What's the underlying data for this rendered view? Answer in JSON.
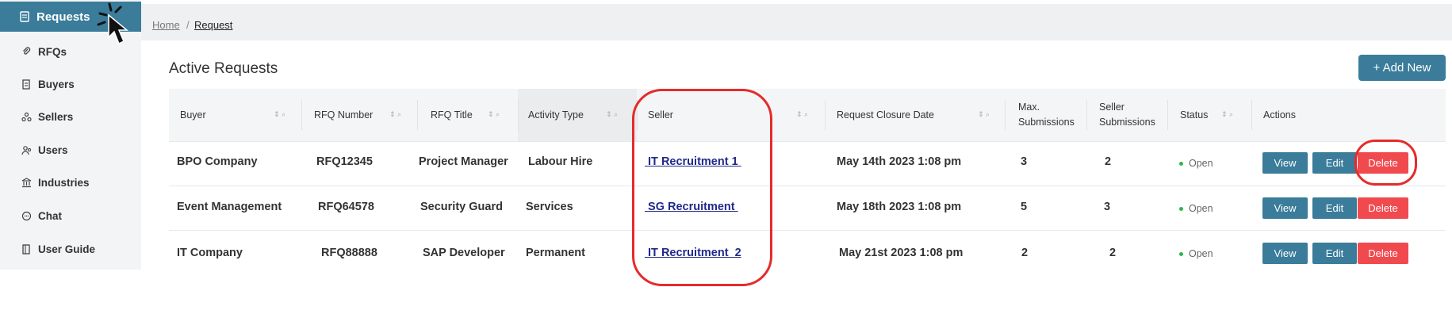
{
  "sidebar": {
    "items": [
      {
        "label": "Requests",
        "icon": "request-doc-icon",
        "active": true
      },
      {
        "label": "RFQs",
        "icon": "paperclip-icon"
      },
      {
        "label": "Buyers",
        "icon": "receipt-icon"
      },
      {
        "label": "Sellers",
        "icon": "sellers-icon"
      },
      {
        "label": "Users",
        "icon": "users-icon"
      },
      {
        "label": "Industries",
        "icon": "bank-icon"
      },
      {
        "label": "Chat",
        "icon": "chat-icon"
      },
      {
        "label": "User Guide",
        "icon": "book-icon"
      }
    ]
  },
  "breadcrumb": {
    "home": "Home",
    "separator": "/",
    "current": "Request"
  },
  "page": {
    "title": "Active Requests",
    "add_button": "+ Add New"
  },
  "table": {
    "headers": {
      "buyer": "Buyer",
      "rfq_number": "RFQ Number",
      "rfq_title": "RFQ Title",
      "activity_type": "Activity Type",
      "seller": "Seller",
      "closure_date": "Request Closure Date",
      "max_submissions_1": "Max.",
      "max_submissions_2": "Submissions",
      "seller_submissions_1": "Seller",
      "seller_submissions_2": "Submissions",
      "status": "Status",
      "actions": "Actions"
    },
    "rows": [
      {
        "buyer": "BPO Company",
        "rfq_number": "RFQ12345",
        "rfq_title": "Project Manager",
        "activity_type": "Labour Hire",
        "seller": " IT Recruitment 1 ",
        "closure_date": "May 14th 2023 1:08 pm",
        "max_submissions": "3",
        "seller_submissions": "2",
        "status": "Open"
      },
      {
        "buyer": "Event Management",
        "rfq_number": "RFQ64578",
        "rfq_title": "Security Guard",
        "activity_type": "Services",
        "seller": " SG Recruitment ",
        "closure_date": "May 18th 2023 1:08 pm",
        "max_submissions": "5",
        "seller_submissions": "3",
        "status": "Open"
      },
      {
        "buyer": "IT Company",
        "rfq_number": "RFQ88888",
        "rfq_title": "SAP Developer",
        "activity_type": "Permanent",
        "seller": " IT Recruitment  2",
        "closure_date": "May 21st 2023 1:08 pm",
        "max_submissions": "2",
        "seller_submissions": "2",
        "status": "Open"
      }
    ],
    "actions": {
      "view": "View",
      "edit": "Edit",
      "delete": "Delete"
    }
  },
  "colors": {
    "primary": "#3a7c9a",
    "danger": "#f04a4f",
    "annotation": "#e52b2b",
    "status_open": "#2db84a"
  }
}
